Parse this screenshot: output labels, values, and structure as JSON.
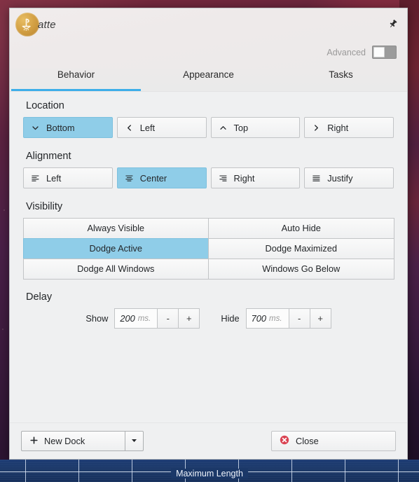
{
  "window": {
    "app_name": "Latte",
    "brand_prefix_icon": "latte-logo-icon",
    "brand_text": "atte",
    "pin_icon": "pin-icon"
  },
  "header": {
    "advanced_label": "Advanced",
    "advanced_toggle_state": "off"
  },
  "tabs": [
    {
      "label": "Behavior",
      "active": true
    },
    {
      "label": "Appearance",
      "active": false
    },
    {
      "label": "Tasks",
      "active": false
    }
  ],
  "sections": {
    "location": {
      "title": "Location",
      "options": [
        {
          "label": "Bottom",
          "icon": "chevron-down-icon",
          "selected": true
        },
        {
          "label": "Left",
          "icon": "chevron-left-icon",
          "selected": false
        },
        {
          "label": "Top",
          "icon": "chevron-up-icon",
          "selected": false
        },
        {
          "label": "Right",
          "icon": "chevron-right-icon",
          "selected": false
        }
      ]
    },
    "alignment": {
      "title": "Alignment",
      "options": [
        {
          "label": "Left",
          "icon": "align-left-icon",
          "selected": false
        },
        {
          "label": "Center",
          "icon": "align-center-icon",
          "selected": true
        },
        {
          "label": "Right",
          "icon": "align-right-icon",
          "selected": false
        },
        {
          "label": "Justify",
          "icon": "align-justify-icon",
          "selected": false
        }
      ]
    },
    "visibility": {
      "title": "Visibility",
      "options": [
        {
          "label": "Always Visible",
          "selected": false
        },
        {
          "label": "Auto Hide",
          "selected": false
        },
        {
          "label": "Dodge Active",
          "selected": true
        },
        {
          "label": "Dodge Maximized",
          "selected": false
        },
        {
          "label": "Dodge All Windows",
          "selected": false
        },
        {
          "label": "Windows Go Below",
          "selected": false
        }
      ]
    },
    "delay": {
      "title": "Delay",
      "show": {
        "label": "Show",
        "value": "200",
        "unit": "ms.",
        "decrement": "-",
        "increment": "+"
      },
      "hide": {
        "label": "Hide",
        "value": "700",
        "unit": "ms.",
        "decrement": "-",
        "increment": "+"
      }
    }
  },
  "footer": {
    "new_dock_label": "New Dock",
    "new_dock_icon": "plus-icon",
    "new_dock_dropdown_icon": "triangle-down-icon",
    "close_label": "Close",
    "close_icon": "error-circle-icon"
  },
  "ruler": {
    "label": "Maximum Length"
  },
  "colors": {
    "accent": "#3daee9",
    "selection": "#8fcde8",
    "window_bg": "#eff0f1",
    "ruler_bg": "#1b3868",
    "close_icon": "#da4453",
    "logo_gold": "#d3a044"
  }
}
